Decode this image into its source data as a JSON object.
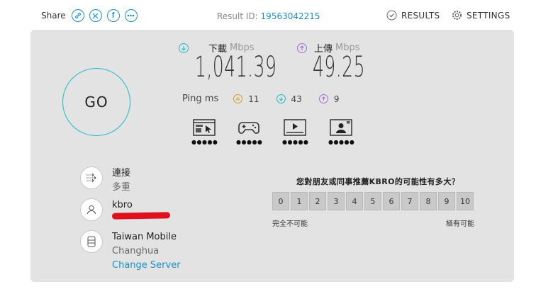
{
  "topbar": {
    "share_label": "Share",
    "share_icons": [
      "link-icon",
      "x-icon",
      "facebook-icon",
      "more-icon"
    ],
    "result_id_label": "Result ID:",
    "result_id_value": "19563042215",
    "results_label": "RESULTS",
    "settings_label": "SETTINGS"
  },
  "go_label": "GO",
  "download": {
    "name": "下載",
    "unit": "Mbps",
    "value": "1,041.39"
  },
  "upload": {
    "name": "上傳",
    "unit": "Mbps",
    "value": "49.25"
  },
  "ping": {
    "label": "Ping",
    "unit": "ms",
    "idle": "11",
    "down": "43",
    "up": "9"
  },
  "quality_icons": [
    {
      "icon": "web-browsing-icon",
      "dots": "●●●●●"
    },
    {
      "icon": "gaming-icon",
      "dots": "●●●●●"
    },
    {
      "icon": "video-streaming-icon",
      "dots": "●●●●●"
    },
    {
      "icon": "video-call-icon",
      "dots": "●●●●●"
    }
  ],
  "connection": {
    "title": "連接",
    "value": "多重"
  },
  "user": {
    "name": "kbro"
  },
  "server": {
    "name": "Taiwan Mobile",
    "location": "Changhua",
    "change_label": "Change Server"
  },
  "survey": {
    "question": "您對朋友或同事推薦KBRO的可能性有多大？",
    "scale": [
      "0",
      "1",
      "2",
      "3",
      "4",
      "5",
      "6",
      "7",
      "8",
      "9",
      "10"
    ],
    "low_label": "完全不可能",
    "high_label": "極有可能"
  },
  "colors": {
    "accent": "#1a8fc4",
    "download": "#1fb9c6",
    "upload": "#a86ad6",
    "ping_idle": "#c9a317",
    "go_ring": "#1fb9c6"
  }
}
